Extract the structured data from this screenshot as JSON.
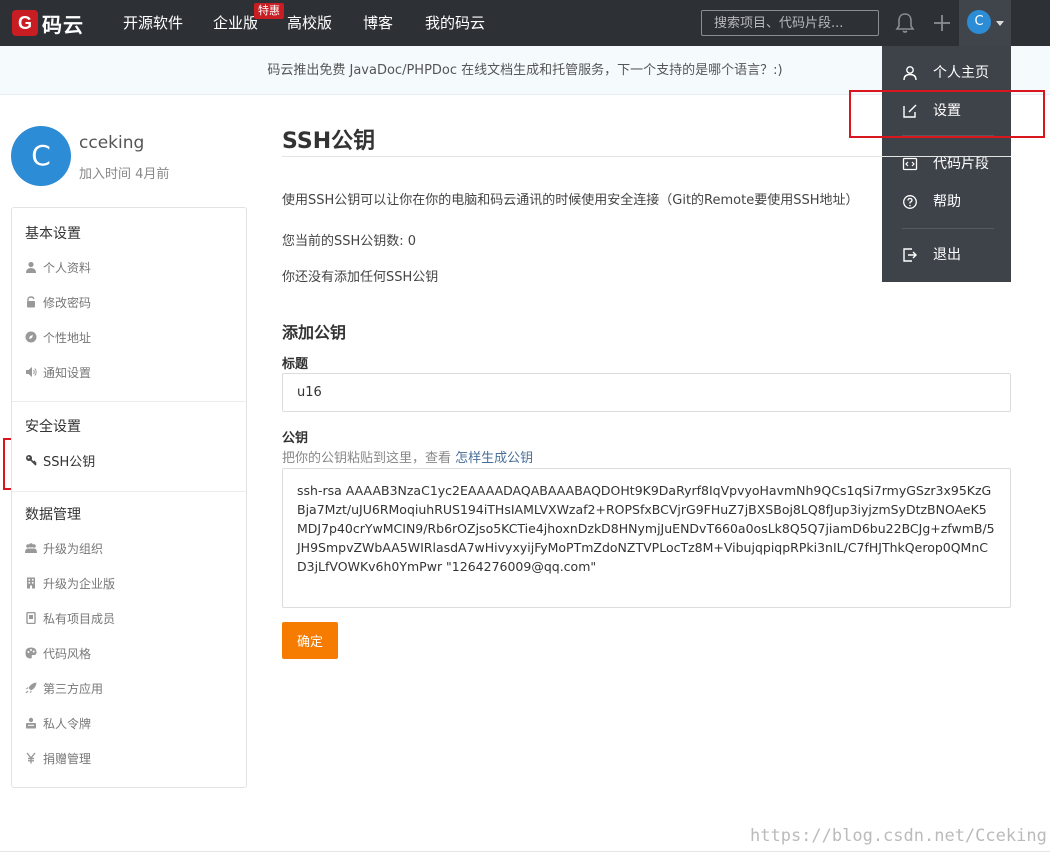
{
  "header": {
    "logo_mark": "G",
    "logo_text": "码云",
    "nav": [
      "开源软件",
      "企业版",
      "高校版",
      "博客",
      "我的码云"
    ],
    "hot_badge": "特惠",
    "search_placeholder": "搜索项目、代码片段...",
    "avatar_letter": "C",
    "icons": [
      "bell-icon",
      "plus-icon",
      "chevron-down-icon"
    ]
  },
  "banner": {
    "text": "码云推出免费 JavaDoc/PHPDoc 在线文档生成和托管服务，下一个支持的是哪个语言？:)"
  },
  "dropdown": {
    "items": [
      {
        "label": "个人主页",
        "icon": "user-icon"
      },
      {
        "label": "设置",
        "icon": "edit-icon"
      },
      {
        "label": "代码片段",
        "icon": "code-icon"
      },
      {
        "label": "帮助",
        "icon": "help-icon"
      },
      {
        "label": "退出",
        "icon": "logout-icon"
      }
    ]
  },
  "profile": {
    "avatar_letter": "C",
    "name": "cceking",
    "joined": "加入时间 4月前"
  },
  "sidebar": {
    "sections": [
      {
        "title": "基本设置",
        "items": [
          {
            "label": "个人资料",
            "icon": "user-icon"
          },
          {
            "label": "修改密码",
            "icon": "lock-icon"
          },
          {
            "label": "个性地址",
            "icon": "compass-icon"
          },
          {
            "label": "通知设置",
            "icon": "speaker-icon"
          }
        ]
      },
      {
        "title": "安全设置",
        "items": [
          {
            "label": "SSH公钥",
            "icon": "key-icon",
            "active": true
          }
        ]
      },
      {
        "title": "数据管理",
        "items": [
          {
            "label": "升级为组织",
            "icon": "users-icon"
          },
          {
            "label": "升级为企业版",
            "icon": "building-icon"
          },
          {
            "label": "私有项目成员",
            "icon": "member-icon"
          },
          {
            "label": "代码风格",
            "icon": "palette-icon"
          },
          {
            "label": "第三方应用",
            "icon": "rocket-icon"
          },
          {
            "label": "私人令牌",
            "icon": "token-icon"
          },
          {
            "label": "捐赠管理",
            "icon": "yen-icon"
          }
        ]
      }
    ]
  },
  "main": {
    "title": "SSH公钥",
    "description": "使用SSH公钥可以让你在你的电脑和码云通讯的时候使用安全连接（Git的Remote要使用SSH地址）",
    "count": "您当前的SSH公钥数: 0",
    "empty": "你还没有添加任何SSH公钥",
    "add_title": "添加公钥",
    "title_label": "标题",
    "title_value": "u16",
    "key_label": "公钥",
    "key_hint": "把你的公钥粘贴到这里，查看",
    "key_hint_link": "怎样生成公钥",
    "key_value": "ssh-rsa AAAAB3NzaC1yc2EAAAADAQABAAABAQDOHt9K9DaRyrf8IqVpvyoHavmNh9QCs1qSi7rmyGSzr3x95KzGBja7Mzt/uJU6RMoqiuhRUS194iTHsIAMLVXWzaf2+ROPSfxBCVjrG9FHuZ7jBXSBoj8LQ8fJup3iyjzmSyDtzBNOAeK5MDJ7p40crYwMCIN9/Rb6rOZjso5KCTie4jhoxnDzkD8HNymjJuENDvT660a0osLk8Q5Q7jiamD6bu22BCJg+zfwmB/5JH9SmpvZWbAA5WIRlasdA7wHivyxyijFyMoPTmZdoNZTVPLocTz8M+VibujqpiqpRPki3nIL/C7fHJThkQerop0QMnCD3jLfVOWKv6h0YmPwr \"1264276009@qq.com\"",
    "submit_label": "确定"
  },
  "watermark": "https://blog.csdn.net/Cceking",
  "colors": {
    "nav_bg": "#2d3035",
    "dropdown_bg": "#3e434a",
    "brand_red": "#c71d23",
    "avatar_blue": "#2d8cd6",
    "button_orange": "#f57c00",
    "highlight_red": "#d9161e"
  }
}
